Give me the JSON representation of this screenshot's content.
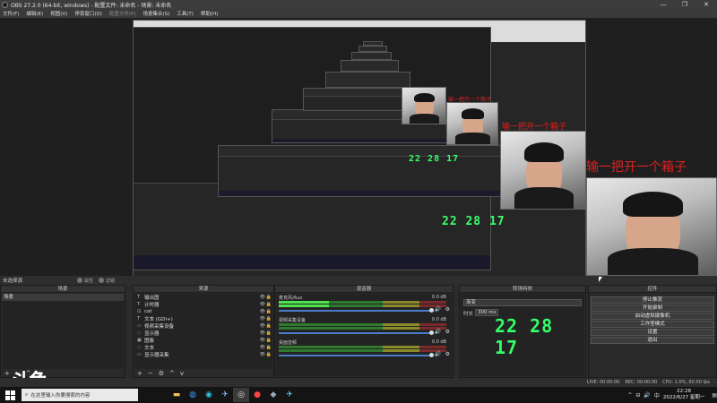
{
  "window": {
    "title": "OBS 27.2.0 (64-bit, windows) - 配置文件: 未命名 - 场景: 未命名",
    "minimize": "—",
    "maximize": "❐",
    "close": "✕"
  },
  "menu": {
    "items": [
      {
        "label": "文件(F)",
        "enabled": true
      },
      {
        "label": "编辑(E)",
        "enabled": true
      },
      {
        "label": "视图(V)",
        "enabled": true
      },
      {
        "label": "停靠窗口(D)",
        "enabled": true
      },
      {
        "label": "配置文件(P)",
        "enabled": false
      },
      {
        "label": "场景集合(S)",
        "enabled": true
      },
      {
        "label": "工具(T)",
        "enabled": true
      },
      {
        "label": "帮助(H)",
        "enabled": true
      }
    ]
  },
  "preview": {
    "red_texts": [
      "输一把开一个箱子",
      "输一把开一个箱子",
      "输一把开一个箱子"
    ],
    "mini_clock": "22 28 17"
  },
  "dock_bar": {
    "no_scene": "未选择源",
    "properties": "属性",
    "filters": "滤镜"
  },
  "scenes": {
    "header": "场景",
    "items": [
      "场景"
    ],
    "footer": [
      "+",
      "−",
      "^",
      "v"
    ]
  },
  "sources": {
    "header": "来源",
    "items": [
      {
        "icon": "T",
        "label": "输出图"
      },
      {
        "icon": "T",
        "label": "计时器"
      },
      {
        "icon": "⊡",
        "label": "cat"
      },
      {
        "icon": "T",
        "label": "文本 (GDI+)"
      },
      {
        "icon": "▭",
        "label": "视频采集设备"
      },
      {
        "icon": "◌",
        "label": "显示器"
      },
      {
        "icon": "▣",
        "label": "图像"
      },
      {
        "icon": "◌",
        "label": "文本"
      },
      {
        "icon": "▭",
        "label": "显示器采集"
      }
    ],
    "footer": [
      "+",
      "−",
      "⚙",
      "^",
      "v"
    ]
  },
  "mixer": {
    "header": "混音器",
    "channels": [
      {
        "name": "麦克风/Aux",
        "db": "0.0 dB",
        "live": true
      },
      {
        "name": "视频采集设备",
        "db": "0.0 dB",
        "live": false
      },
      {
        "name": "桌面音频",
        "db": "0.0 dB",
        "live": false
      }
    ]
  },
  "transitions": {
    "header": "转场特效",
    "selected": "渐变",
    "duration_label": "时长",
    "duration_value": "300 ms",
    "clock": "22 28 17"
  },
  "controls": {
    "header": "控件",
    "buttons": [
      "停止推流",
      "开始录制",
      "启动虚拟摄像机",
      "工作室模式",
      "设置",
      "退出"
    ]
  },
  "status": {
    "items": [
      "LIVE: 00:00:00",
      "REC: 00:00:00",
      "CPU: 1.0%, 60.00 fps"
    ]
  },
  "taskbar": {
    "search_placeholder": "在这里输入你要搜索的内容",
    "time": "22:28",
    "date": "2022/6/27 星期一",
    "lang": "中"
  },
  "logo_text": "斗鱼"
}
